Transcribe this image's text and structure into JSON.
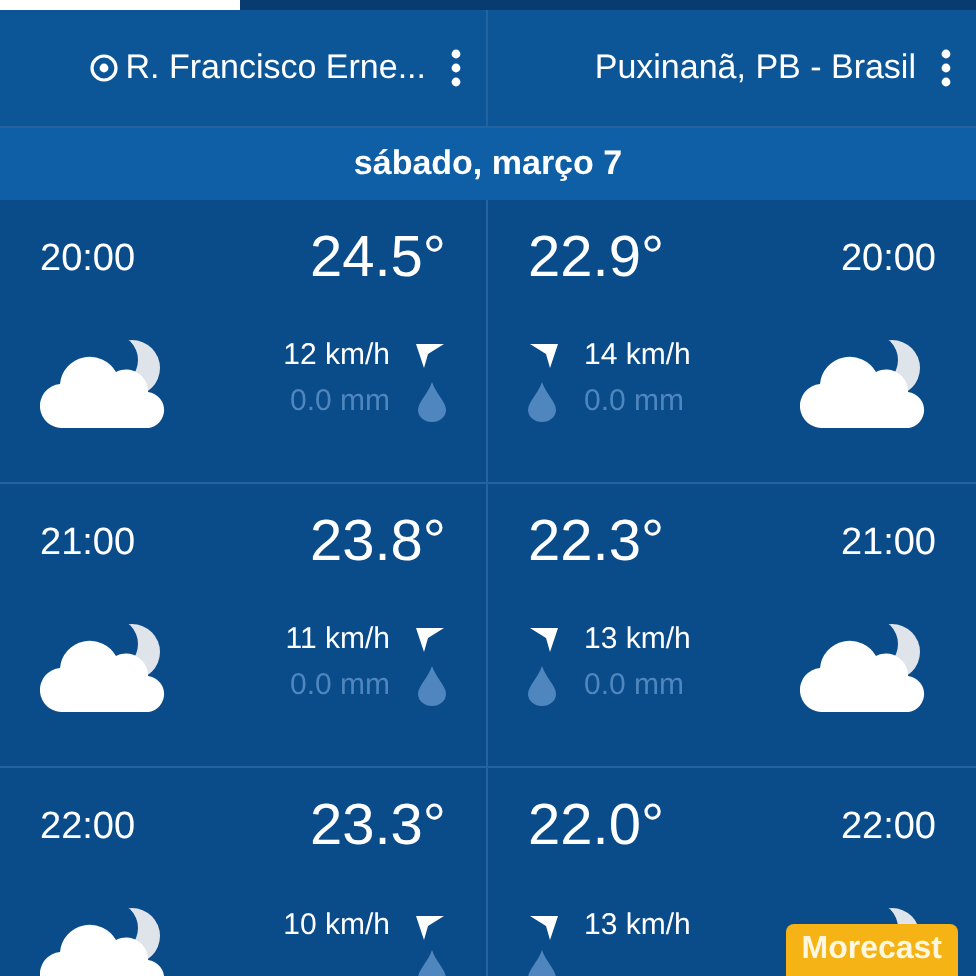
{
  "locations": [
    {
      "name": "R. Francisco Erne...",
      "current": true
    },
    {
      "name": "Puxinanã, PB - Brasil",
      "current": false
    }
  ],
  "date": "sábado, março 7",
  "rows": [
    {
      "cells": [
        {
          "time": "20:00",
          "temp": "24.5°",
          "wind": "12 km/h",
          "rain": "0.0 mm"
        },
        {
          "time": "20:00",
          "temp": "22.9°",
          "wind": "14 km/h",
          "rain": "0.0 mm"
        }
      ]
    },
    {
      "cells": [
        {
          "time": "21:00",
          "temp": "23.8°",
          "wind": "11 km/h",
          "rain": "0.0 mm"
        },
        {
          "time": "21:00",
          "temp": "22.3°",
          "wind": "13 km/h",
          "rain": "0.0 mm"
        }
      ]
    },
    {
      "cells": [
        {
          "time": "22:00",
          "temp": "23.3°",
          "wind": "10 km/h"
        },
        {
          "time": "22:00",
          "temp": "22.0°",
          "wind": "13 km/h"
        }
      ]
    }
  ],
  "badge": "Morecast"
}
